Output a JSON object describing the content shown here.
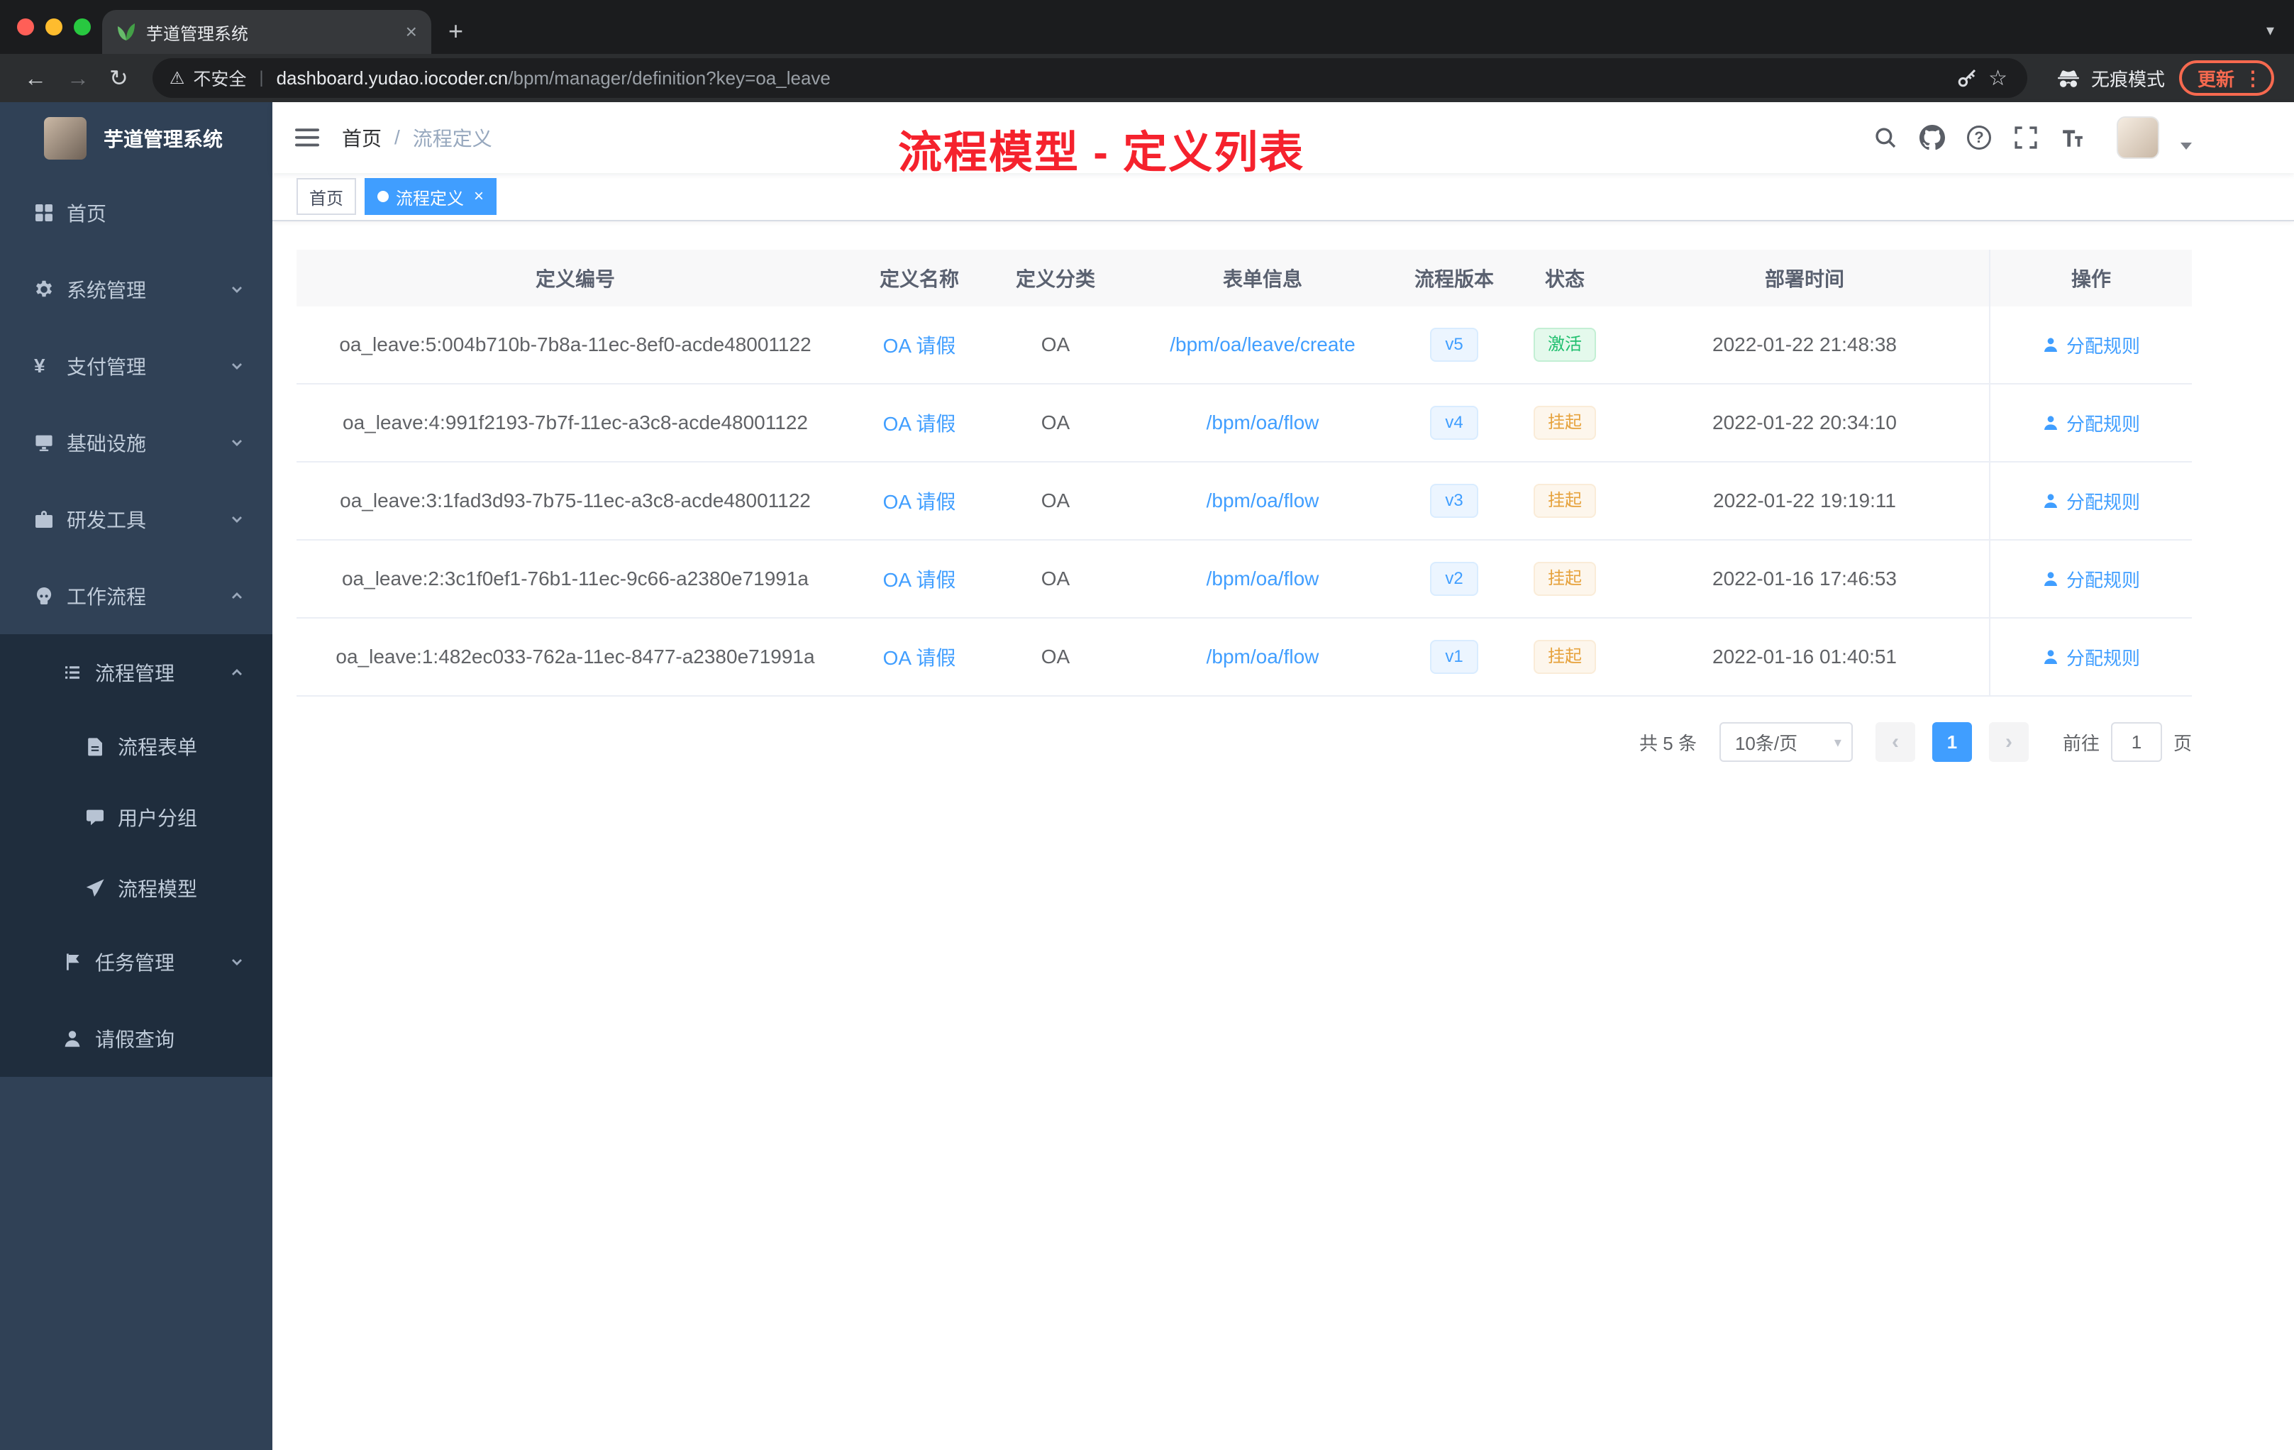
{
  "browser": {
    "tab": {
      "title": "芋道管理系统"
    },
    "toolbar": {
      "security_label": "不安全",
      "url_domain": "dashboard.yudao.iocoder.cn",
      "url_path": "/bpm/manager/definition?key=oa_leave",
      "incognito_label": "无痕模式",
      "update_label": "更新"
    }
  },
  "annotation": {
    "text": "流程模型 - 定义列表"
  },
  "sidebar": {
    "logo_title": "芋道管理系统",
    "menu": [
      {
        "label": "首页",
        "icon": "dashboard-icon"
      },
      {
        "label": "系统管理",
        "icon": "gear-icon"
      },
      {
        "label": "支付管理",
        "icon": "payment-icon"
      },
      {
        "label": "基础设施",
        "icon": "infrastructure-icon"
      },
      {
        "label": "研发工具",
        "icon": "devtools-icon"
      },
      {
        "label": "工作流程",
        "icon": "workflow-icon"
      },
      {
        "label": "流程管理",
        "icon": "process-manage-icon"
      },
      {
        "label": "流程表单",
        "icon": "form-icon"
      },
      {
        "label": "用户分组",
        "icon": "user-group-icon"
      },
      {
        "label": "流程模型",
        "icon": "process-model-icon"
      },
      {
        "label": "任务管理",
        "icon": "task-icon"
      },
      {
        "label": "请假查询",
        "icon": "user-icon"
      }
    ]
  },
  "navbar": {
    "breadcrumb": {
      "home": "首页",
      "separator": "/",
      "current": "流程定义"
    }
  },
  "tags": [
    {
      "label": "首页",
      "active": false
    },
    {
      "label": "流程定义",
      "active": true
    }
  ],
  "table": {
    "columns": [
      "定义编号",
      "定义名称",
      "定义分类",
      "表单信息",
      "流程版本",
      "状态",
      "部署时间",
      "操作"
    ],
    "action_label": "分配规则",
    "rows": [
      {
        "id": "oa_leave:5:004b710b-7b8a-11ec-8ef0-acde48001122",
        "name": "OA 请假",
        "category": "OA",
        "form": "/bpm/oa/leave/create",
        "version": "v5",
        "status": "激活",
        "status_type": "success",
        "time": "2022-01-22 21:48:38"
      },
      {
        "id": "oa_leave:4:991f2193-7b7f-11ec-a3c8-acde48001122",
        "name": "OA 请假",
        "category": "OA",
        "form": "/bpm/oa/flow",
        "version": "v4",
        "status": "挂起",
        "status_type": "warning",
        "time": "2022-01-22 20:34:10"
      },
      {
        "id": "oa_leave:3:1fad3d93-7b75-11ec-a3c8-acde48001122",
        "name": "OA 请假",
        "category": "OA",
        "form": "/bpm/oa/flow",
        "version": "v3",
        "status": "挂起",
        "status_type": "warning",
        "time": "2022-01-22 19:19:11"
      },
      {
        "id": "oa_leave:2:3c1f0ef1-76b1-11ec-9c66-a2380e71991a",
        "name": "OA 请假",
        "category": "OA",
        "form": "/bpm/oa/flow",
        "version": "v2",
        "status": "挂起",
        "status_type": "warning",
        "time": "2022-01-16 17:46:53"
      },
      {
        "id": "oa_leave:1:482ec033-762a-11ec-8477-a2380e71991a",
        "name": "OA 请假",
        "category": "OA",
        "form": "/bpm/oa/flow",
        "version": "v1",
        "status": "挂起",
        "status_type": "warning",
        "time": "2022-01-16 01:40:51"
      }
    ]
  },
  "pagination": {
    "total": "共 5 条",
    "page_size": "10条/页",
    "current_page": "1",
    "goto_label": "前往",
    "goto_value": "1",
    "page_suffix": "页"
  },
  "glyphs": {
    "close": "×",
    "plus": "+",
    "chevron_down": "▾",
    "back": "←",
    "forward": "→",
    "reload": "↻",
    "warning": "⚠",
    "separator": "|",
    "star": "☆",
    "dots_vertical": "⋮",
    "question": "?",
    "prev": "‹",
    "next": "›",
    "yen": "¥",
    "select_caret": "▾"
  },
  "colors": {
    "accent": "#409eff",
    "annotation_red": "#f5222d",
    "status_active_green": "#1fbf6e",
    "status_suspend_orange": "#e6a23c",
    "sidebar_bg": "#304156",
    "submenu_bg": "#1f2d3d",
    "update_chip": "#f6694f"
  }
}
